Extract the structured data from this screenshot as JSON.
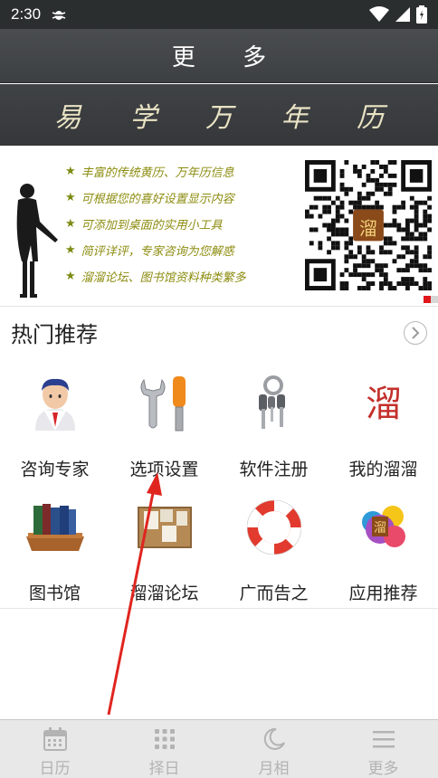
{
  "status_bar": {
    "time": "2:30"
  },
  "header": {
    "title": "更 多"
  },
  "banner": {
    "text": "易 学 万 年 历"
  },
  "promo": {
    "lines": [
      "丰富的传统黄历、万年历信息",
      "可根据您的喜好设置显示内容",
      "可添加到桌面的实用小工具",
      "简评详评，专家咨询为您解惑",
      "溜溜论坛、图书馆资料种类繁多"
    ],
    "qr_center_text": "溜"
  },
  "section": {
    "title": "热门推荐",
    "more_icon": "chevron-right-icon"
  },
  "grid": {
    "items": [
      {
        "label": "咨询专家",
        "icon": "expert-icon"
      },
      {
        "label": "选项设置",
        "icon": "tools-icon"
      },
      {
        "label": "软件注册",
        "icon": "keys-icon"
      },
      {
        "label": "我的溜溜",
        "icon": "seal-icon"
      },
      {
        "label": "图书馆",
        "icon": "books-icon"
      },
      {
        "label": "溜溜论坛",
        "icon": "board-icon"
      },
      {
        "label": "广而告之",
        "icon": "lifebuoy-icon"
      },
      {
        "label": "应用推荐",
        "icon": "balls-icon"
      }
    ],
    "seal_char": "溜"
  },
  "bottom_nav": {
    "items": [
      {
        "label": "日历",
        "icon": "calendar-icon"
      },
      {
        "label": "择日",
        "icon": "grid-icon"
      },
      {
        "label": "月相",
        "icon": "moon-icon"
      },
      {
        "label": "更多",
        "icon": "menu-icon"
      }
    ]
  },
  "colors": {
    "accent_red": "#e0171b",
    "promo_text": "#8c8c10",
    "header_bg": "#3d4042"
  }
}
